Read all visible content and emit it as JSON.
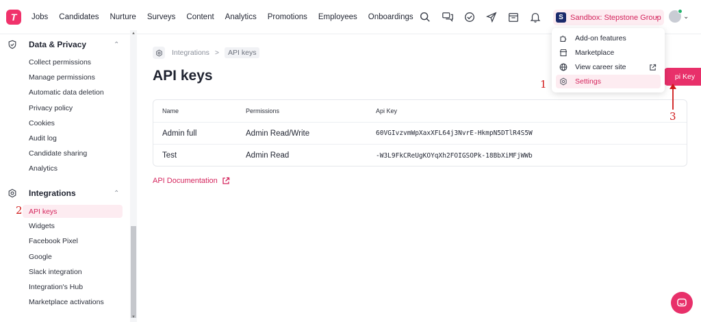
{
  "nav": [
    "Jobs",
    "Candidates",
    "Nurture",
    "Surveys",
    "Content",
    "Analytics",
    "Promotions",
    "Employees",
    "Onboardings"
  ],
  "tenant": {
    "initial": "S",
    "name": "Sandbox: Stepstone Group",
    "chevron": "⌄"
  },
  "sidebar": {
    "data_privacy": {
      "title": "Data & Privacy",
      "items": [
        "Collect permissions",
        "Manage permissions",
        "Automatic data deletion",
        "Privacy policy",
        "Cookies",
        "Audit log",
        "Candidate sharing",
        "Analytics"
      ]
    },
    "integrations": {
      "title": "Integrations",
      "items": [
        "API keys",
        "Widgets",
        "Facebook Pixel",
        "Google",
        "Slack integration",
        "Integration's Hub",
        "Marketplace activations"
      ]
    }
  },
  "breadcrumb": {
    "parent": "Integrations",
    "separator": ">",
    "current": "API keys"
  },
  "page_title": "API keys",
  "new_key_button": "pi Key",
  "table": {
    "headers": [
      "Name",
      "Permissions",
      "Api Key"
    ],
    "rows": [
      [
        "Admin full",
        "Admin Read/Write",
        "60VGIvzvmWpXaxXFL64j3NvrE-HkmpN5DTlR4S5W"
      ],
      [
        "Test",
        "Admin Read",
        "-W3L9FkCReUgKOYqXh2FOIGSOPk-18BbXiMFjWWb"
      ]
    ]
  },
  "api_doc_link": "API Documentation",
  "dropdown": {
    "items": [
      "Add-on features",
      "Marketplace",
      "View career site",
      "Settings"
    ]
  },
  "annotations": [
    "1",
    "2",
    "3"
  ],
  "colors": {
    "accent": "#e8306a",
    "accent_bg": "#fdecf1",
    "annotation": "#d01818"
  }
}
